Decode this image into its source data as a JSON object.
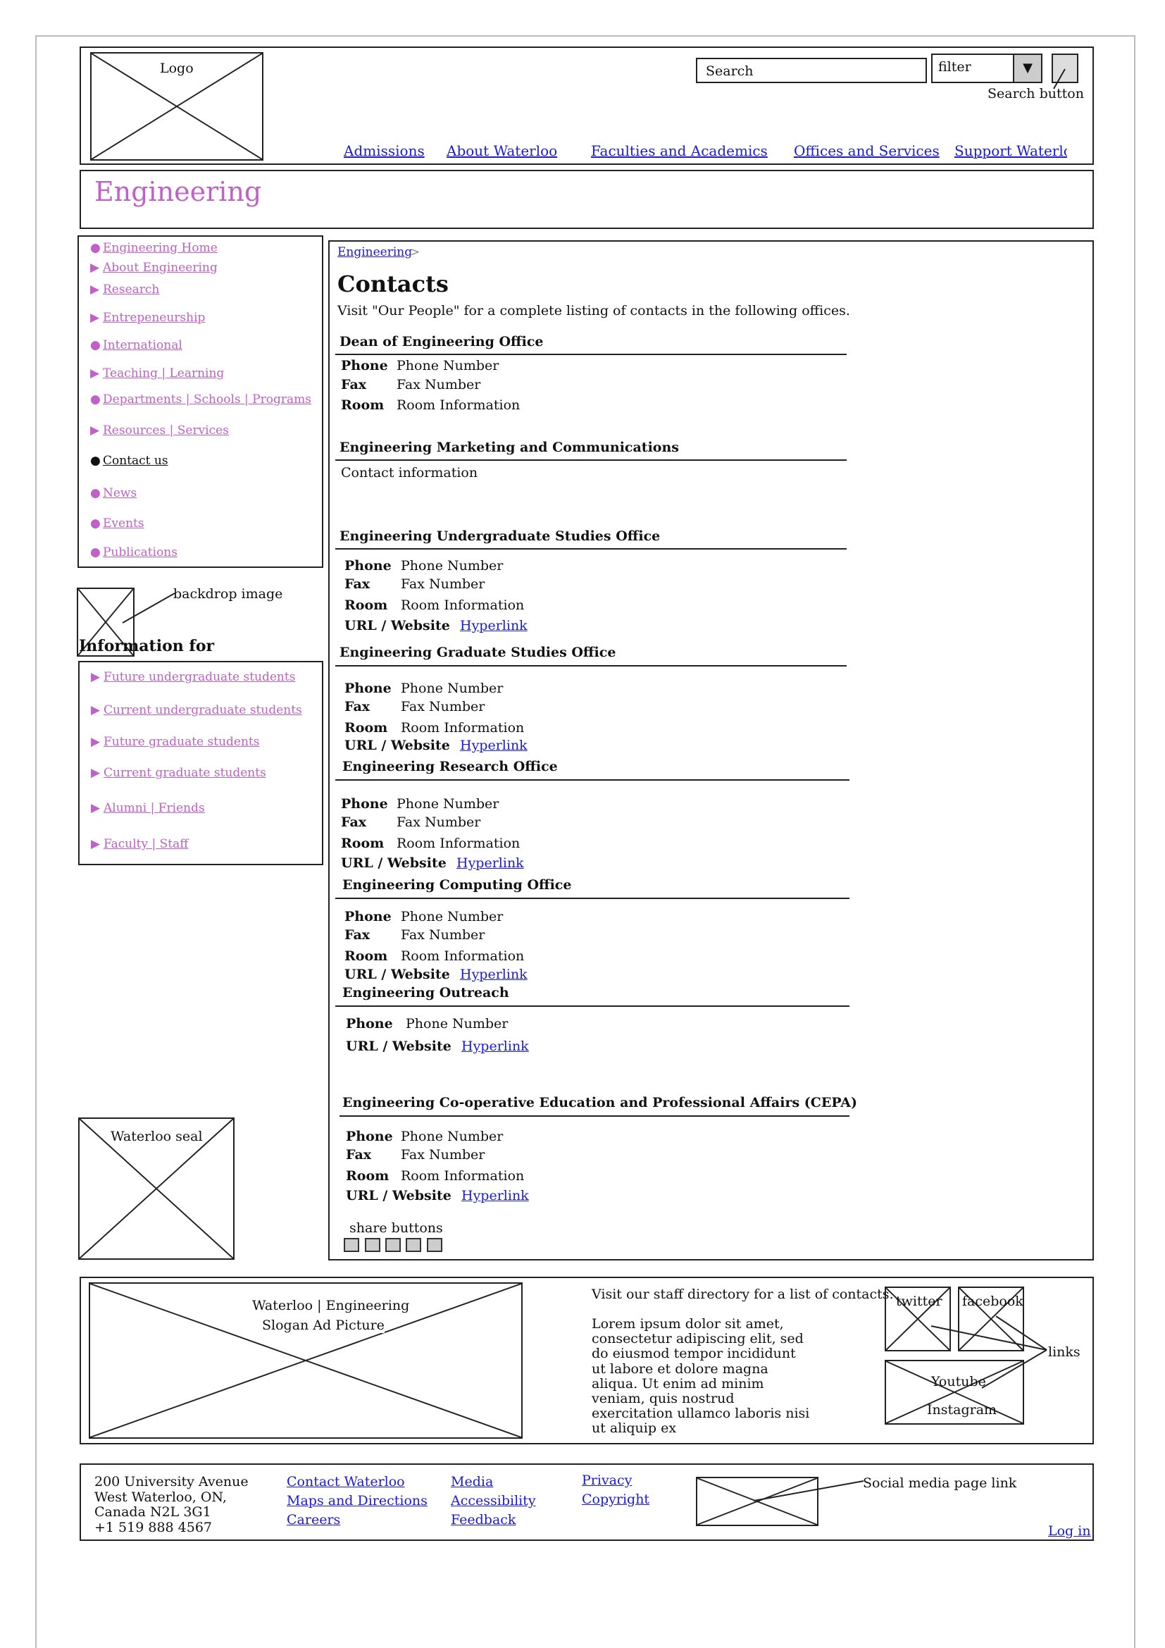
{
  "header": {
    "logo_label": "Logo",
    "search_placeholder": "Search",
    "filter_value": "filter",
    "search_button_label": "Search button",
    "nav": [
      "Admissions",
      "About Waterloo",
      "Faculties and Academics",
      "Offices and Services",
      "Support Waterloo"
    ]
  },
  "banner": {
    "title": "Engineering",
    "color": "#c060c8"
  },
  "sidebar": {
    "items": [
      {
        "marker": "●",
        "label": "Engineering  Home"
      },
      {
        "marker": "▶",
        "label": "About  Engineering"
      },
      {
        "marker": "▶",
        "label": "Research"
      },
      {
        "marker": "▶",
        "label": "Entrepeneurship"
      },
      {
        "marker": "●",
        "label": "International"
      },
      {
        "marker": "▶",
        "label": "Teaching  |  Learning"
      },
      {
        "marker": "●",
        "label": "Departments  |  Schools  |  Programs"
      },
      {
        "marker": "▶",
        "label": "Resources  |  Services"
      },
      {
        "marker": "●",
        "label": "Contact  us"
      },
      {
        "marker": "●",
        "label": "News"
      },
      {
        "marker": "●",
        "label": "Events"
      },
      {
        "marker": "●",
        "label": "Publications"
      }
    ],
    "backdrop_label": "backdrop image",
    "info_heading": "Information for",
    "info_items": [
      {
        "marker": "▶",
        "label": "Future  undergraduate  students"
      },
      {
        "marker": "▶",
        "label": "Current  undergraduate  students"
      },
      {
        "marker": "▶",
        "label": "Future  graduate  students"
      },
      {
        "marker": "▶",
        "label": "Current  graduate  students"
      },
      {
        "marker": "▶",
        "label": "Alumni  |  Friends"
      },
      {
        "marker": "▶",
        "label": "Faculty  |  Staff"
      }
    ],
    "seal_label": "Waterloo seal"
  },
  "main": {
    "breadcrumb": "Engineering",
    "breadcrumb_sep": ">",
    "title": "Contacts",
    "intro": "Visit \"Our People\" for a complete listing of contacts in the following offices.",
    "labels": {
      "phone": "Phone",
      "fax": "Fax",
      "room": "Room",
      "url": "URL / Website"
    },
    "values": {
      "phone": "Phone Number",
      "fax": "Fax Number",
      "room": "Room Information",
      "url": "Hyperlink"
    },
    "sections": [
      "Dean of Engineering Office",
      "Engineering Marketing and Communications",
      "Engineering Undergraduate Studies Office",
      "Engineering Graduate Studies Office",
      "Engineering Research Office",
      "Engineering Computing Office",
      "Engineering Outreach",
      "Engineering Co-operative Education and Professional Affairs (CEPA)"
    ],
    "contact_info": "Contact information",
    "share_label": "share buttons"
  },
  "footer_top": {
    "ad_line1": "Waterloo | Engineering",
    "ad_line2": "Slogan Ad Picture",
    "directory_text": "Visit our staff directory for a list of contacts.",
    "lorem": [
      "Lorem ipsum dolor sit amet,",
      "consectetur adipiscing elit, sed",
      "do eiusmod tempor incididunt",
      "ut labore et dolore magna",
      "aliqua. Ut enim ad minim",
      "veniam, quis nostrud",
      "exercitation ullamco laboris nisi",
      "ut aliquip ex"
    ],
    "twitter": "twitter",
    "facebook": "facebook",
    "youtube": "Youtube",
    "instagram": "Instagram",
    "links_label": "links"
  },
  "footer_bottom": {
    "address": [
      "200 University Avenue",
      "West Waterloo, ON,",
      "Canada  N2L 3G1",
      "+1 519 888 4567"
    ],
    "col1": [
      "Contact Waterloo",
      "Maps and Directions",
      "Careers"
    ],
    "col2": [
      "Media",
      "Accessibility",
      "Feedback"
    ],
    "col3": [
      "Privacy",
      "Copyright"
    ],
    "social_label": "Social media page link",
    "login": "Log in"
  }
}
